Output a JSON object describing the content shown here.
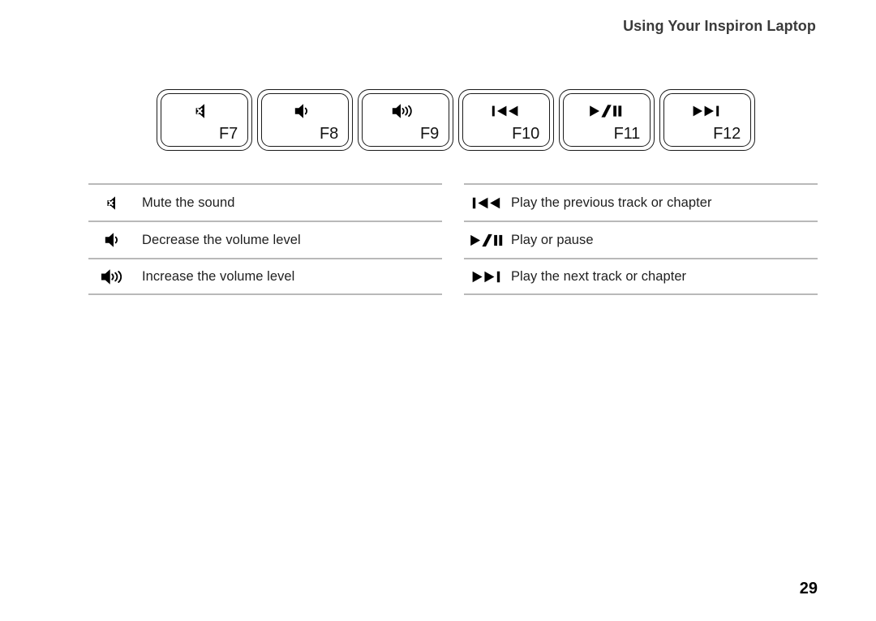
{
  "header": {
    "title": "Using Your Inspiron Laptop"
  },
  "keys": [
    {
      "label": "F7",
      "icon": "mute-icon"
    },
    {
      "label": "F8",
      "icon": "volume-down-icon"
    },
    {
      "label": "F9",
      "icon": "volume-up-icon"
    },
    {
      "label": "F10",
      "icon": "previous-track-icon"
    },
    {
      "label": "F11",
      "icon": "play-pause-icon"
    },
    {
      "label": "F12",
      "icon": "next-track-icon"
    }
  ],
  "legend_left": {
    "rows": [
      {
        "icon": "mute-icon",
        "text": "Mute the sound"
      },
      {
        "icon": "volume-down-icon",
        "text": "Decrease the volume level"
      },
      {
        "icon": "volume-up-icon",
        "text": "Increase the volume level"
      }
    ]
  },
  "legend_right": {
    "rows": [
      {
        "icon": "previous-track-icon",
        "text": "Play the previous track or chapter"
      },
      {
        "icon": "play-pause-icon",
        "text": "Play or pause"
      },
      {
        "icon": "next-track-icon",
        "text": "Play the next track or chapter"
      }
    ]
  },
  "footer": {
    "page_number": "29"
  },
  "colors": {
    "header_text": "#3a3a3a",
    "body_text": "#1f1f1f",
    "rule": "#b9b9b9",
    "key_outline": "#1b1b1b",
    "icon": "#000000",
    "page_bg": "#ffffff"
  }
}
